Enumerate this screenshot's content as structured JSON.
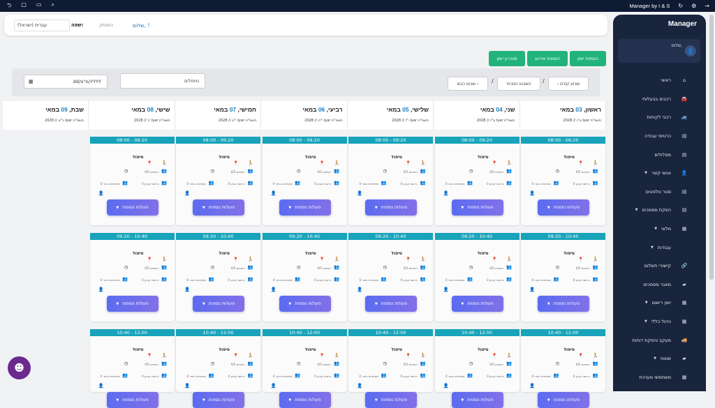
{
  "window": {
    "title": "Manager by I & S"
  },
  "sidebar": {
    "brand": "Manager",
    "user_greeting": "שלום,",
    "items": [
      {
        "label": "ראשי",
        "icon": "home-icon",
        "glyph": "⌂",
        "caret": false
      },
      {
        "label": "רכבים בבעלותי",
        "icon": "car-icon",
        "glyph": "🚘",
        "caret": false
      },
      {
        "label": "רכבי לקוחות",
        "icon": "car-side-icon",
        "glyph": "🚙",
        "caret": false
      },
      {
        "label": "כרטיסי עבודה",
        "icon": "file-icon",
        "glyph": "▤",
        "caret": false
      },
      {
        "label": "מסלולים",
        "icon": "file-lines-icon",
        "glyph": "▤",
        "caret": false
      },
      {
        "label": "אנשי קשר",
        "icon": "user-icon",
        "glyph": "👤",
        "caret": true
      },
      {
        "label": "סטר טלפונים",
        "icon": "file-icon",
        "glyph": "▤",
        "caret": false
      },
      {
        "label": "הפקת מסמכים",
        "icon": "file-export-icon",
        "glyph": "▤",
        "caret": true
      },
      {
        "label": "מלאי",
        "icon": "warehouse-icon",
        "glyph": "▦",
        "caret": true
      },
      {
        "label": "עבודות",
        "icon": "tools-icon",
        "glyph": "",
        "caret": true
      },
      {
        "label": "קישורי תשלום",
        "icon": "link-icon",
        "glyph": "🔗",
        "caret": false
      },
      {
        "label": "מאגר מסמכים",
        "icon": "folder-icon",
        "glyph": "▰",
        "caret": false
      },
      {
        "label": "יומן רישום",
        "icon": "calendar-icon",
        "glyph": "▦",
        "caret": true
      },
      {
        "label": "ניהול כללי",
        "icon": "calendar-check-icon",
        "glyph": "▦",
        "caret": true
      },
      {
        "label": "מעקב והפקת דוחות",
        "icon": "truck-icon",
        "glyph": "🚚",
        "caret": false
      },
      {
        "label": "שונות",
        "icon": "folder-icon",
        "glyph": "▰",
        "caret": true
      },
      {
        "label": "משתמשי מערכת",
        "icon": "users-cog-icon",
        "glyph": "▦",
        "caret": false
      }
    ]
  },
  "topbar": {
    "greeting": "שלום, !",
    "logout": "התנתק",
    "language_label": "שפה:",
    "language_value": "עברית (ישראל)"
  },
  "actions": {
    "add_diary": "הוספת יומן",
    "add_event": "הוספת אירוע",
    "sync_diary": "סנכרון יומן"
  },
  "toolbar": {
    "prev_week": "שבוע קודם",
    "current_week": "השבוע הנוכחי",
    "next_week": "שבוע הבא",
    "sep": "/",
    "search_value": "טיפולים",
    "date_placeholder": "dd/מ\"מ/YYYY"
  },
  "days": [
    {
      "name": "ראשון, ",
      "num": "03",
      "month": " במאי",
      "hebrew": "2028 // ט\"ו Iyar תשפ\"ח"
    },
    {
      "name": "שני, ",
      "num": "04",
      "month": " במאי",
      "hebrew": "2028 // ט\"ז Iyar תשפ\"ח"
    },
    {
      "name": "שלישי, ",
      "num": "05",
      "month": " במאי",
      "hebrew": "2028 // י\"ז Iyar תשפ\"ח"
    },
    {
      "name": "רביעי, ",
      "num": "06",
      "month": " במאי",
      "hebrew": "2028 // י\"ח Iyar תשפ\"ח"
    },
    {
      "name": "חמישי, ",
      "num": "07",
      "month": " במאי",
      "hebrew": "2028 // י\"ט Iyar תשפ\"ח"
    },
    {
      "name": "שישי, ",
      "num": "08",
      "month": " במאי",
      "hebrew": "2028 // כ' Iyar תשפ\"ח"
    },
    {
      "name": "שבת, ",
      "num": "09",
      "month": " במאי",
      "hebrew": "2028 // כ\"א Iyar תשפ\"ח"
    }
  ],
  "slots": [
    {
      "time": "08:00 - 09:20"
    },
    {
      "time": "09:20 - 10:40"
    },
    {
      "time": "10:40 - 12:00"
    }
  ],
  "slot_card": {
    "title": "טיפול",
    "registrants": "0/5 רשומים",
    "waiting": "0 ממתינים בתור",
    "registered_label": "0 נרשמו קבוע",
    "actions_button": "פעולות נוספות"
  }
}
